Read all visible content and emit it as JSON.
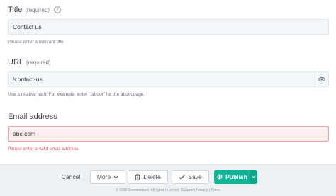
{
  "form": {
    "title_field": {
      "label": "Title",
      "required": "(required)",
      "value": "Contact us",
      "hint": "Please enter a relevant title"
    },
    "url_field": {
      "label": "URL",
      "required": "(required)",
      "value": "/contact-us",
      "hint": "Use a relative path. For example, enter \"/about\" for the about page."
    },
    "email_field": {
      "label": "Email address",
      "value": "abc.com",
      "error": "Please enter a valid email address."
    }
  },
  "footer": {
    "cancel_label": "Cancel",
    "more_label": "More",
    "delete_label": "Delete",
    "save_label": "Save",
    "publish_label": "Publish",
    "copyright": "© 2020 Contentstack. All rights reserved. Support | Privacy | Terms"
  },
  "colors": {
    "publish": "#10b598",
    "error": "#e25660",
    "input_bg": "#f3f9fb"
  }
}
